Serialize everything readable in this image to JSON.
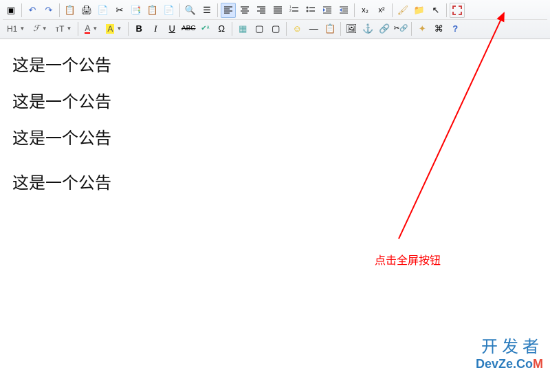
{
  "toolbar": {
    "row1": {
      "source": "▣",
      "undo": "↶",
      "redo": "↷",
      "paste": "📋",
      "print": "🖨",
      "new": "📄",
      "cut": "✂",
      "copy": "📑",
      "paste2": "📋",
      "pasteword": "📄",
      "findreplace": "🔍",
      "selectall": "☰",
      "align_left": "≡",
      "align_center": "≡",
      "align_right": "≡",
      "align_justify": "≡",
      "ol": "⋮≡",
      "ul": "•≡",
      "indent": "→≡",
      "outdent": "←≡",
      "sub": "x₂",
      "sup": "x²",
      "brush": "🖌",
      "folder": "📁",
      "cursor": "↖",
      "fullscreen": "⛶"
    },
    "row2": {
      "heading": "H1",
      "font": "ℱ",
      "fontsize": "тT",
      "fontcolor": "A",
      "hilite": "A",
      "bold": "B",
      "italic": "I",
      "underline": "U",
      "strike": "ABC",
      "spellcheck": "✔ᵃ",
      "insertchar": "Ω",
      "table": "▦",
      "tableborder": "▢",
      "cell": "▢",
      "smiley": "☺",
      "hr": "—",
      "paste3": "📋",
      "image": "🖼",
      "anchor": "⚓",
      "link": "🔗",
      "unlink": "✂🔗",
      "sparkle": "✦",
      "code": "⌘",
      "help": "?"
    }
  },
  "content": [
    "这是一个公告",
    "这是一个公告",
    "这是一个公告",
    "这是一个公告"
  ],
  "annotation": {
    "text": "点击全屏按钮"
  },
  "watermark": {
    "cn": "开发者",
    "en_prefix": "DevZe.Co",
    "en_suffix": "M"
  }
}
